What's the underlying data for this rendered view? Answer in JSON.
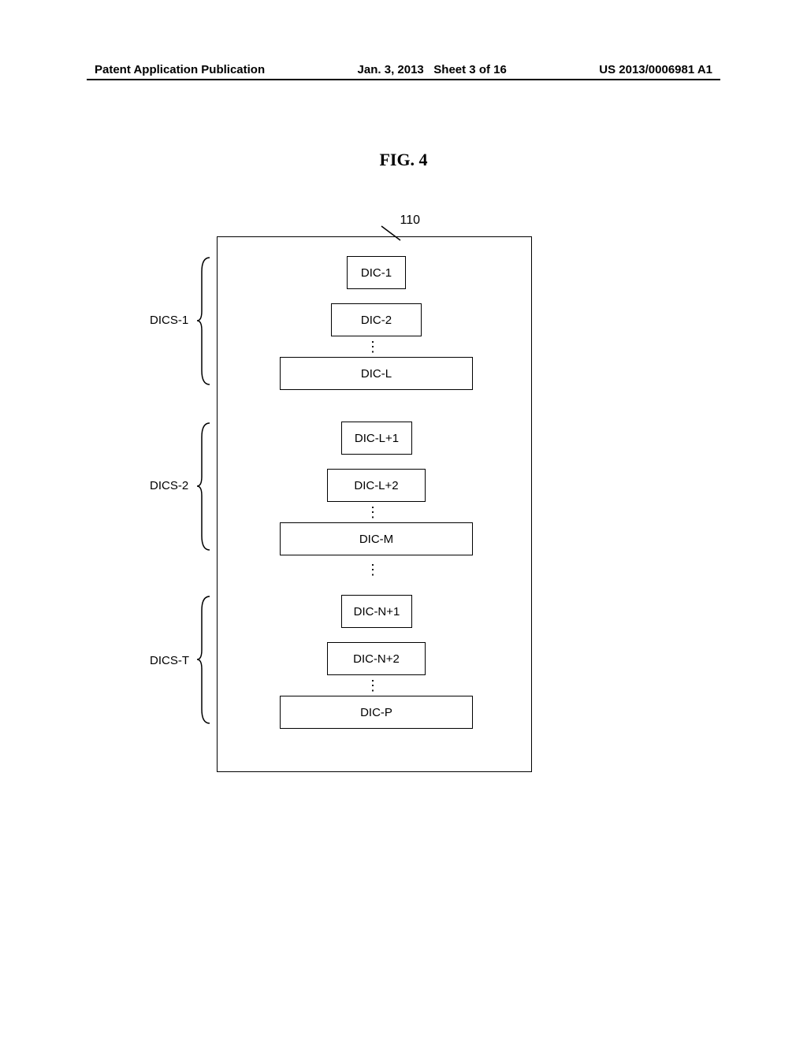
{
  "header": {
    "left": "Patent Application Publication",
    "center_date": "Jan. 3, 2013",
    "center_sheet": "Sheet 3 of 16",
    "right": "US 2013/0006981 A1"
  },
  "figure": {
    "title": "FIG.  4",
    "ref_number": "110"
  },
  "groups": [
    {
      "label": "DICS-1",
      "items": [
        "DIC-1",
        "DIC-2",
        "DIC-L"
      ]
    },
    {
      "label": "DICS-2",
      "items": [
        "DIC-L+1",
        "DIC-L+2",
        "DIC-M"
      ]
    },
    {
      "label": "DICS-T",
      "items": [
        "DIC-N+1",
        "DIC-N+2",
        "DIC-P"
      ]
    }
  ],
  "vdots": "⋮"
}
